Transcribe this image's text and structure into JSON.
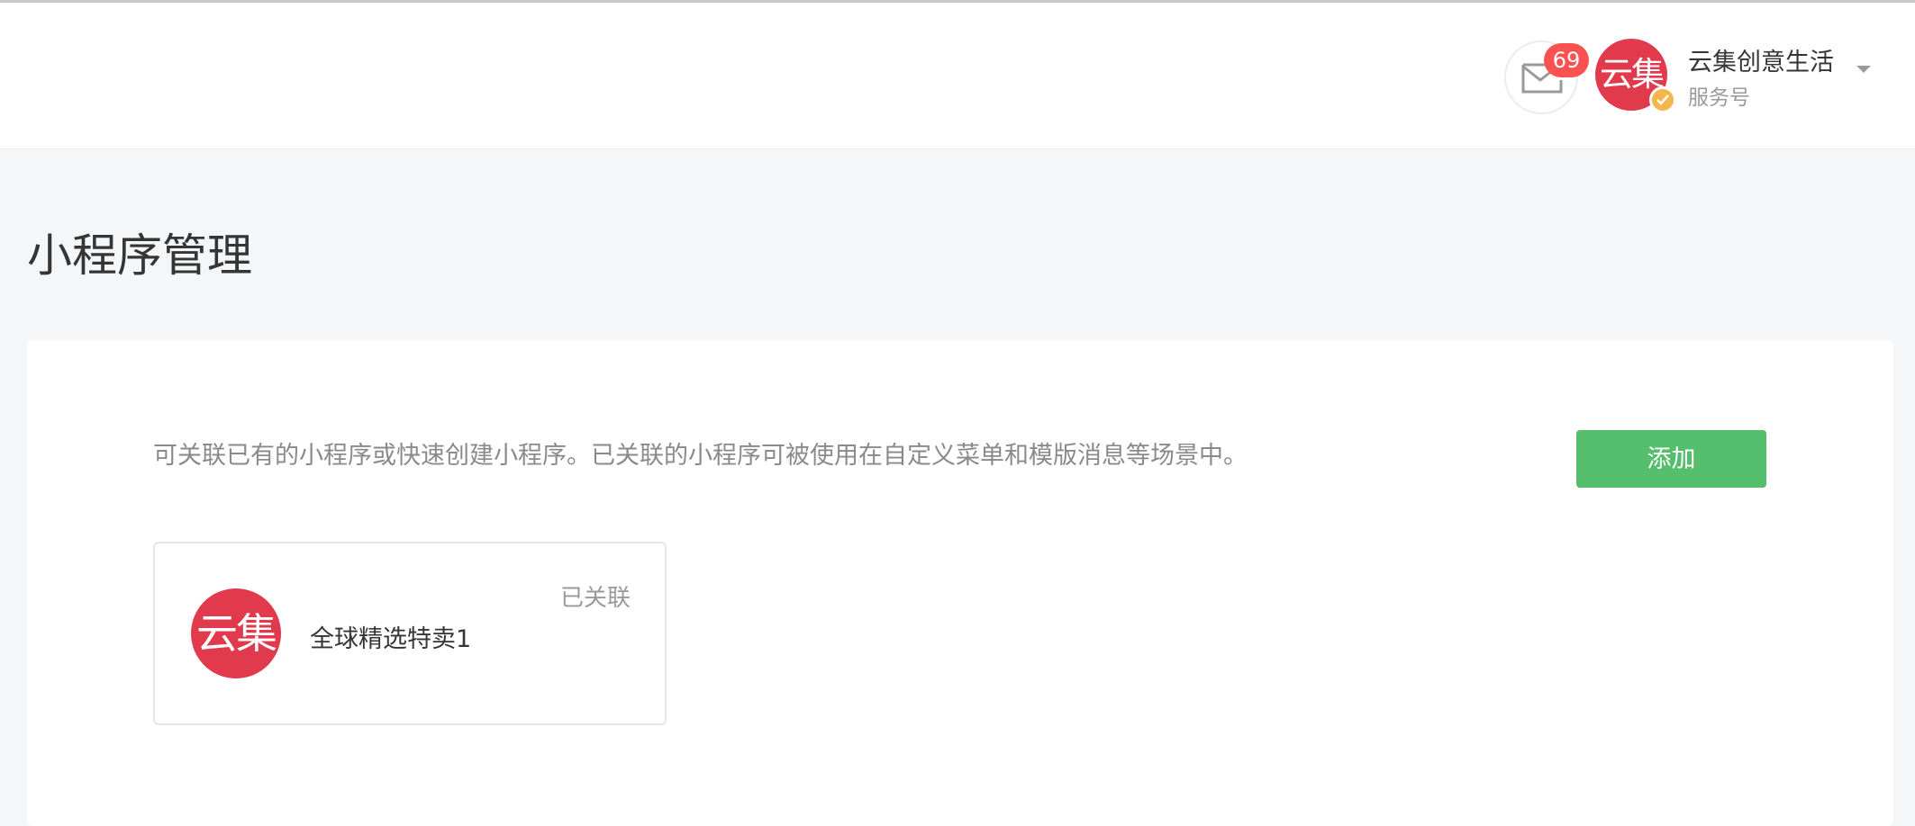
{
  "header": {
    "mail_badge_count": "69",
    "account": {
      "avatar_text": "云集",
      "name": "云集创意生活",
      "type": "服务号"
    }
  },
  "page": {
    "title": "小程序管理"
  },
  "panel": {
    "description": "可关联已有的小程序或快速创建小程序。已关联的小程序可被使用在自定义菜单和模版消息等场景中。",
    "add_button_label": "添加",
    "mini_programs": [
      {
        "avatar_text": "云集",
        "name": "全球精选特卖1",
        "status": "已关联"
      }
    ]
  },
  "colors": {
    "accent_green": "#55be6c",
    "badge_red": "#fa5151",
    "avatar_red": "#e13a4c",
    "verify_orange": "#f5b74b",
    "page_background": "#f5f6f8"
  },
  "icons": {
    "mail": "mail-icon",
    "verified": "verified-check-icon",
    "dropdown": "chevron-down-icon"
  }
}
